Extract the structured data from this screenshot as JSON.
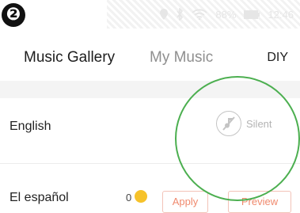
{
  "step_badge": "❷",
  "status_bar": {
    "battery": "88%",
    "time": "12:46"
  },
  "tabs": {
    "music_gallery": "Music Gallery",
    "my_music": "My Music",
    "diy": "DIY"
  },
  "languages": [
    {
      "name": "English",
      "status": "Silent"
    },
    {
      "name": "El español",
      "coins": "0",
      "apply": "Apply",
      "preview": "Preview"
    }
  ],
  "colors": {
    "highlight": "#4caf50",
    "accent": "#f08a6e",
    "coin": "#f6c22a"
  },
  "icons": {
    "silent": "muted-music-note-icon",
    "coin": "coin-icon"
  }
}
